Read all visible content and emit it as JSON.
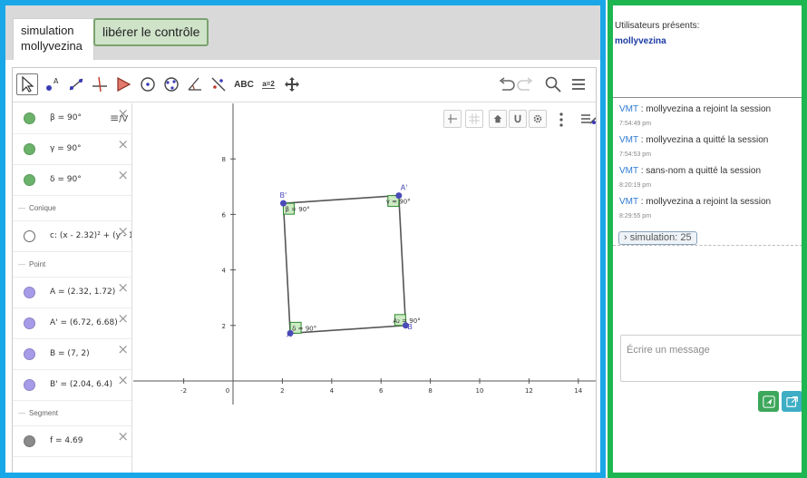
{
  "tabs": {
    "simulation_label": "simulation mollyvezina",
    "release_control": "libérer le contrôle"
  },
  "toolbar": {
    "text_tool": "ABC",
    "slider_tool": "a=2"
  },
  "algebra": {
    "rows": [
      {
        "type": "item",
        "color": "#6bb36b",
        "text": "β = 90°"
      },
      {
        "type": "item",
        "color": "#6bb36b",
        "text": "γ = 90°"
      },
      {
        "type": "item",
        "color": "#6bb36b",
        "text": "δ = 90°"
      },
      {
        "type": "header",
        "text": "Conique"
      },
      {
        "type": "item",
        "color": "#ffffff",
        "text": "c: (x - 2.32)² + (y - 1."
      },
      {
        "type": "header",
        "text": "Point"
      },
      {
        "type": "item",
        "color": "#a59be8",
        "text": "A = (2.32, 1.72)"
      },
      {
        "type": "item",
        "color": "#a59be8",
        "text": "A' = (6.72, 6.68)"
      },
      {
        "type": "item",
        "color": "#a59be8",
        "text": "B = (7, 2)"
      },
      {
        "type": "item",
        "color": "#a59be8",
        "text": "B' = (2.04, 6.4)"
      },
      {
        "type": "header",
        "text": "Segment"
      },
      {
        "type": "item",
        "color": "#8a8a8a",
        "text": "f = 4.69"
      }
    ]
  },
  "graph": {
    "x_ticks": [
      "-2",
      "0",
      "2",
      "4",
      "6",
      "8",
      "10",
      "12",
      "14"
    ],
    "y_ticks": [
      "2",
      "4",
      "6",
      "8"
    ],
    "points": [
      {
        "label": "B'",
        "x": 2.04,
        "y": 6.4
      },
      {
        "label": "A'",
        "x": 6.72,
        "y": 6.68
      },
      {
        "label": "B",
        "x": 7,
        "y": 2
      },
      {
        "label": "A",
        "x": 2.32,
        "y": 1.72
      }
    ],
    "angle_labels": [
      "β = 90°",
      "γ = 90°",
      "A₂ = 90°",
      "δ = 90°"
    ]
  },
  "chat": {
    "users_title": "Utilisateurs présents:",
    "users": [
      "mollyvezina"
    ],
    "messages": [
      {
        "author": "VMT",
        "text": " : mollyvezina a rejoint la session",
        "time": "7:54:49 pm"
      },
      {
        "author": "VMT",
        "text": " : mollyvezina a quitté la session",
        "time": "7:54:53 pm"
      },
      {
        "author": "VMT",
        "text": " : sans-nom a quitté la session",
        "time": "8:20:19 pm"
      },
      {
        "author": "VMT",
        "text": " : mollyvezina a rejoint la session",
        "time": "8:29:55 pm"
      }
    ],
    "simulation_chip": "›  simulation: 25",
    "input_placeholder": "Écrire un message"
  },
  "colors": {
    "left_frame": "#1aa7e8",
    "right_frame": "#1eb651",
    "point": "#4a4ab8",
    "angle": "#2e8b2e"
  }
}
